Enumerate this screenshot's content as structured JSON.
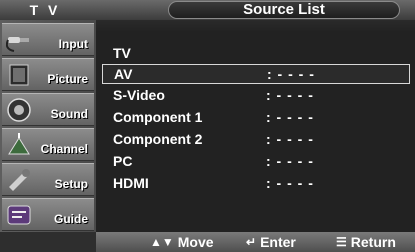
{
  "header": {
    "mode_title": "T V",
    "page_title": "Source List"
  },
  "sidebar": {
    "items": [
      {
        "label": "Input",
        "icon": "input-cable-icon"
      },
      {
        "label": "Picture",
        "icon": "picture-icon"
      },
      {
        "label": "Sound",
        "icon": "speaker-icon"
      },
      {
        "label": "Channel",
        "icon": "antenna-icon"
      },
      {
        "label": "Setup",
        "icon": "setup-icon"
      },
      {
        "label": "Guide",
        "icon": "program-guide-icon"
      }
    ]
  },
  "source_list": {
    "items": [
      {
        "name": "TV",
        "value": ""
      },
      {
        "name": "AV",
        "value": ": - - - -"
      },
      {
        "name": "S-Video",
        "value": ": - - - -"
      },
      {
        "name": "Component 1",
        "value": ": - - - -"
      },
      {
        "name": "Component 2",
        "value": ": - - - -"
      },
      {
        "name": "PC",
        "value": ": - - - -"
      },
      {
        "name": "HDMI",
        "value": ": - - - -"
      }
    ],
    "selected_index": 1
  },
  "footer": {
    "move_label": "Move",
    "enter_label": "Enter",
    "return_label": "Return"
  },
  "colors": {
    "highlight_border": "#d8d8d8",
    "background": "#222222"
  }
}
